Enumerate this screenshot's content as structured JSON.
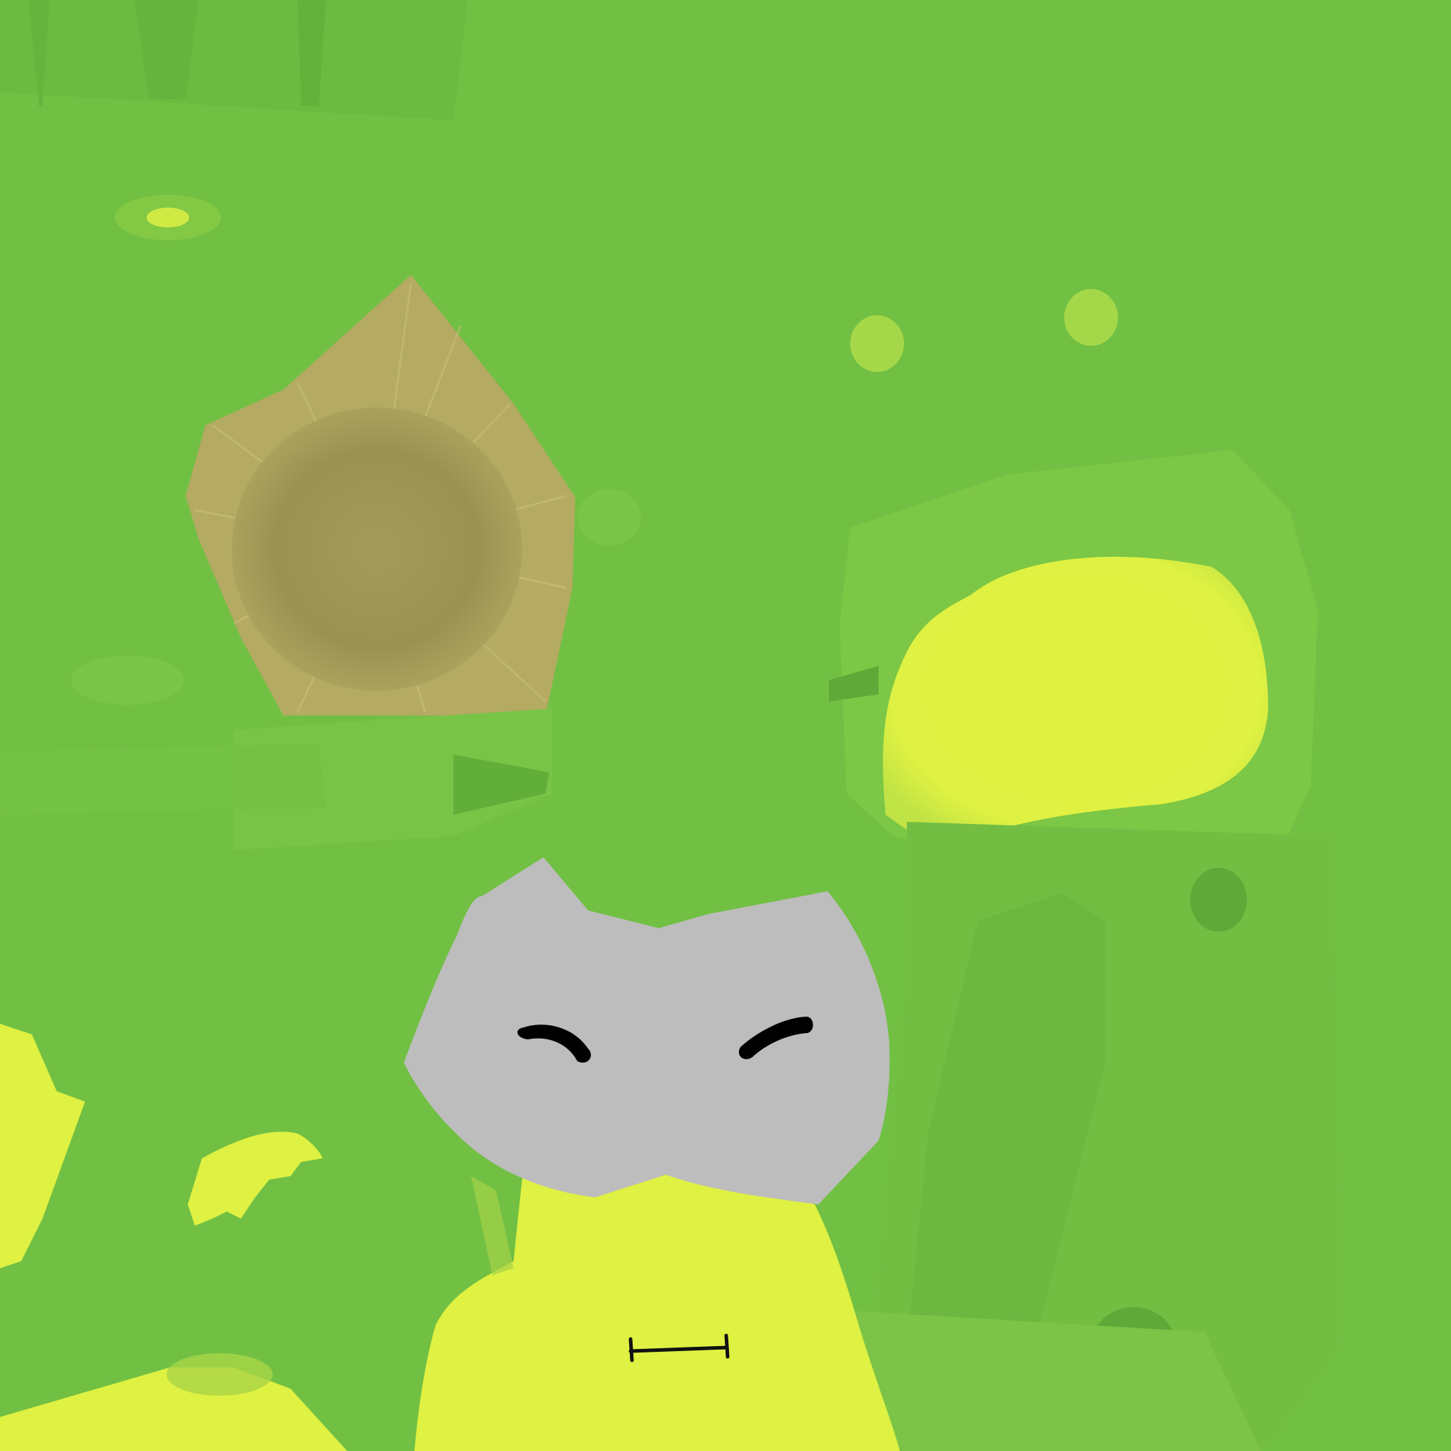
{
  "colors": {
    "background": "#71c043",
    "background_light": "#7cc744",
    "background_dark": "#5fae38",
    "yellow": "#dff142",
    "yellow_soft": "#c8ea44",
    "mask_gray": "#bdbdbd",
    "sun_tan": "#b4aa62",
    "sun_core": "#9d9554",
    "ink": "#000000"
  },
  "scene": {
    "elements": [
      "texture-atlas-background",
      "sun-emblem",
      "gray-mask-face",
      "yellow-body",
      "yellow-lens",
      "small-dots"
    ]
  }
}
